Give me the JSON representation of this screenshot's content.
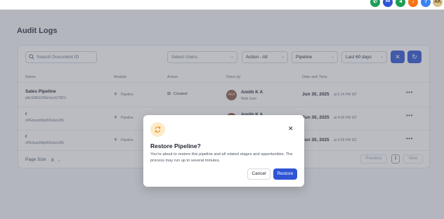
{
  "header": {
    "icons": [
      {
        "name": "phone-icon",
        "glyph": "✆",
        "color": "#1f9d55"
      },
      {
        "name": "link-icon",
        "glyph": "⚯",
        "color": "#2f55d4"
      },
      {
        "name": "megaphone-icon",
        "glyph": "◄",
        "color": "#1f9d55"
      },
      {
        "name": "bell-icon",
        "glyph": "♪",
        "color": "#f97316"
      },
      {
        "name": "help-icon",
        "glyph": "?",
        "color": "#3b82f6"
      },
      {
        "name": "user-avatar-icon",
        "glyph": "AK",
        "color": "#d6c28a"
      }
    ]
  },
  "page": {
    "title": "Audit Logs"
  },
  "filters": {
    "search_placeholder": "Search Document ID",
    "users_placeholder": "Select Users",
    "action_value": "Action - All",
    "module_value": "Pipeline",
    "date_value": "Last 60 days"
  },
  "table": {
    "headers": {
      "name": "Name",
      "module": "Module",
      "action": "Action",
      "done_by": "Done by",
      "date": "Date and Time"
    },
    "rows": [
      {
        "name": "Sales Pipeline",
        "id": "p8cXkBGXD6eVyxG7DF3",
        "module": "Pipeline",
        "action": "Created",
        "user": "Amith K A",
        "user_sub": "Web User",
        "date": "Jun 30, 2025",
        "time": "at 5:14 PM IST"
      },
      {
        "name": "r",
        "id": "oPEdszp9NpWSobmJ5h",
        "module": "Pipeline",
        "action": "",
        "user": "Amith K A",
        "user_sub": "",
        "date": "Jun 30, 2025",
        "time": "at 4:30 PM IST"
      },
      {
        "name": "r",
        "id": "oPEdszp9NpWSobmJ5h",
        "module": "Pipeline",
        "action": "",
        "user": "",
        "user_sub": "",
        "date": "Jun 30, 2025",
        "time": "at 4:29 PM IST"
      }
    ]
  },
  "pagination": {
    "page_size_label": "Page Size",
    "page_size_value": "8",
    "previous": "Previous",
    "current_page": "1",
    "next": "Next"
  },
  "modal": {
    "title": "Restore Pipeline?",
    "body": "You're about to restore this pipeline and all related stages and opportunities. The process may run up to several minutes.",
    "cancel": "Cancel",
    "confirm": "Restore"
  },
  "colors": {
    "primary": "#2f55d4",
    "warning_bg": "#fdebc8",
    "warning_fg": "#e7901a"
  }
}
